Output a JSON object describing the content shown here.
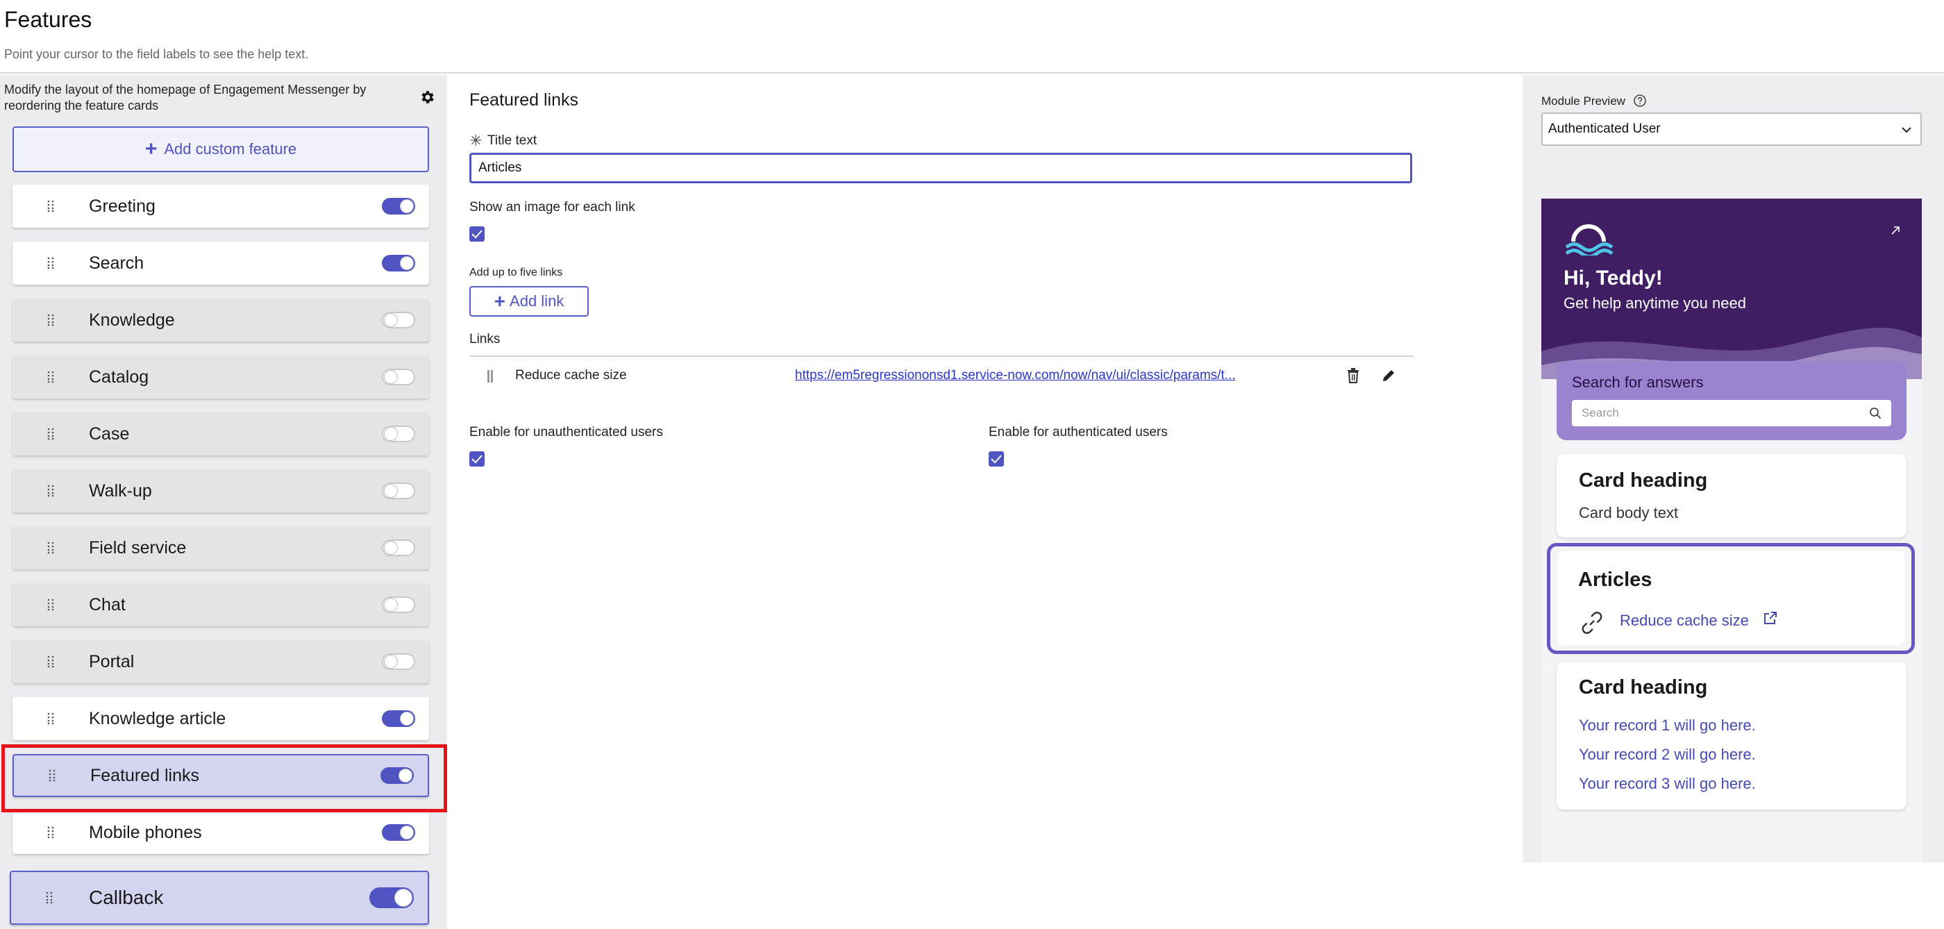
{
  "header": {
    "title": "Features",
    "subtitle": "Point your cursor to the field labels to see the help text."
  },
  "sidebar": {
    "description": "Modify the layout of the homepage of Engagement Messenger by reordering the feature cards",
    "add_button_label": "Add custom feature",
    "features": [
      {
        "label": "Greeting",
        "enabled": true
      },
      {
        "label": "Search",
        "enabled": true
      },
      {
        "label": "Knowledge",
        "enabled": false
      },
      {
        "label": "Catalog",
        "enabled": false
      },
      {
        "label": "Case",
        "enabled": false
      },
      {
        "label": "Walk-up",
        "enabled": false
      },
      {
        "label": "Field service",
        "enabled": false
      },
      {
        "label": "Chat",
        "enabled": false
      },
      {
        "label": "Portal",
        "enabled": false
      },
      {
        "label": "Knowledge article",
        "enabled": true
      },
      {
        "label": "Featured links",
        "enabled": true,
        "selected": true
      },
      {
        "label": "Mobile phones",
        "enabled": true
      },
      {
        "label": "Callback",
        "enabled": true,
        "dragging": true
      }
    ]
  },
  "editor": {
    "title": "Featured links",
    "title_text_label": "Title text",
    "title_text_value": "Articles",
    "show_image_label": "Show an image for each link",
    "show_image_checked": true,
    "add_links_hint": "Add up to five links",
    "add_link_label": "Add link",
    "links_label": "Links",
    "links": [
      {
        "label": "Reduce cache size",
        "url": "https://em5regressiononsd1.service-now.com/now/nav/ui/classic/params/t..."
      }
    ],
    "unauth_label": "Enable for unauthenticated users",
    "unauth_checked": true,
    "auth_label": "Enable for authenticated users",
    "auth_checked": true
  },
  "preview": {
    "label": "Module Preview",
    "selected_user": "Authenticated User",
    "greeting": "Hi, Teddy!",
    "greeting_sub": "Get help anytime you need",
    "search_title": "Search for answers",
    "search_placeholder": "Search",
    "card1_heading": "Card heading",
    "card1_body": "Card body text",
    "articles_heading": "Articles",
    "articles_link": "Reduce cache size",
    "card2_heading": "Card heading",
    "records": [
      "Your record 1 will go here.",
      "Your record 2 will go here.",
      "Your record 3 will go here."
    ]
  },
  "colors": {
    "accent": "#4f54c2",
    "hero": "#3f1e63",
    "highlight": "#e5141b"
  }
}
